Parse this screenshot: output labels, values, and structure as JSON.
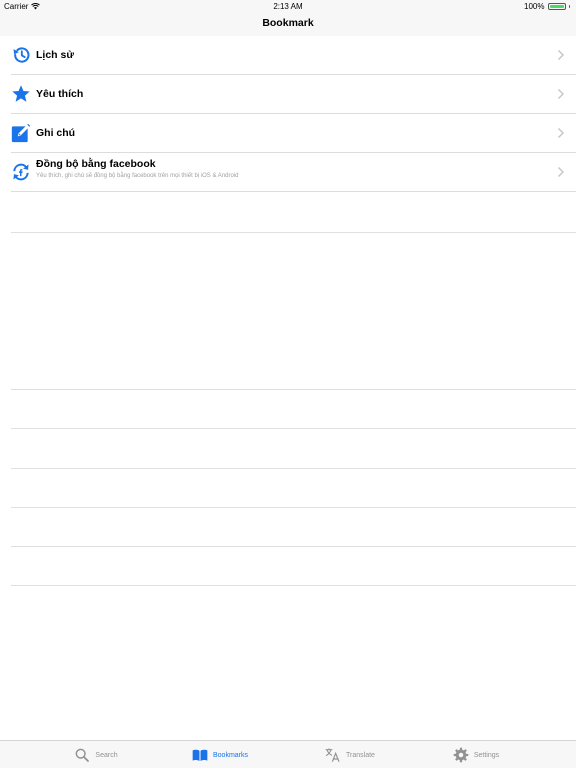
{
  "status": {
    "carrier": "Carrier",
    "time": "2:13 AM",
    "battery": "100%"
  },
  "nav": {
    "title": "Bookmark"
  },
  "items": [
    {
      "label": "Lịch sử",
      "icon": "history-icon"
    },
    {
      "label": "Yêu thích",
      "icon": "star-icon"
    },
    {
      "label": "Ghi chú",
      "icon": "note-edit-icon"
    },
    {
      "label": "Đồng bộ bằng facebook",
      "sublabel": "Yêu thích, ghi chú sẽ đồng bộ bằng facebook trên mọi thiết bị iOS & Android",
      "icon": "sync-icon"
    }
  ],
  "tabs": [
    {
      "label": "Search",
      "icon": "search-icon",
      "active": false
    },
    {
      "label": "Bookmarks",
      "icon": "book-icon",
      "active": true
    },
    {
      "label": "Translate",
      "icon": "translate-icon",
      "active": false
    },
    {
      "label": "Settings",
      "icon": "gear-icon",
      "active": false
    }
  ],
  "colors": {
    "accent": "#1a73e8",
    "inactive": "#929292",
    "bar_bg": "#f7f7f7",
    "separator": "#dcdcdc"
  }
}
